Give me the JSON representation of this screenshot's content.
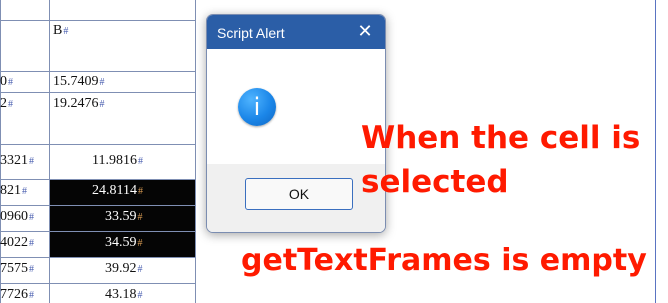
{
  "table": {
    "col_a_header": "",
    "col_b_header": "B",
    "pilcrow": "#",
    "rows": [
      {
        "a": "0",
        "b": "15.7409"
      },
      {
        "a": "2",
        "b": "19.2476"
      },
      {
        "a": "3321",
        "b": "11.9816"
      },
      {
        "a": "821",
        "b": "24.8114"
      },
      {
        "a": "0960",
        "b": "33.59"
      },
      {
        "a": "4022",
        "b": "34.59"
      },
      {
        "a": "7575",
        "b": "39.92"
      },
      {
        "a": "7726",
        "b": "43.18"
      }
    ]
  },
  "dialog": {
    "title": "Script Alert",
    "close_symbol": "✕",
    "icon_name": "info-icon",
    "icon_glyph": "i",
    "ok_label": "OK"
  },
  "annotations": {
    "line1": "When the cell is",
    "line2": "selected",
    "line3": "getTextFrames is empty"
  },
  "colors": {
    "annotation": "#ff1a00",
    "titlebar": "#2b5ea7",
    "selected_cell": "#050505"
  }
}
